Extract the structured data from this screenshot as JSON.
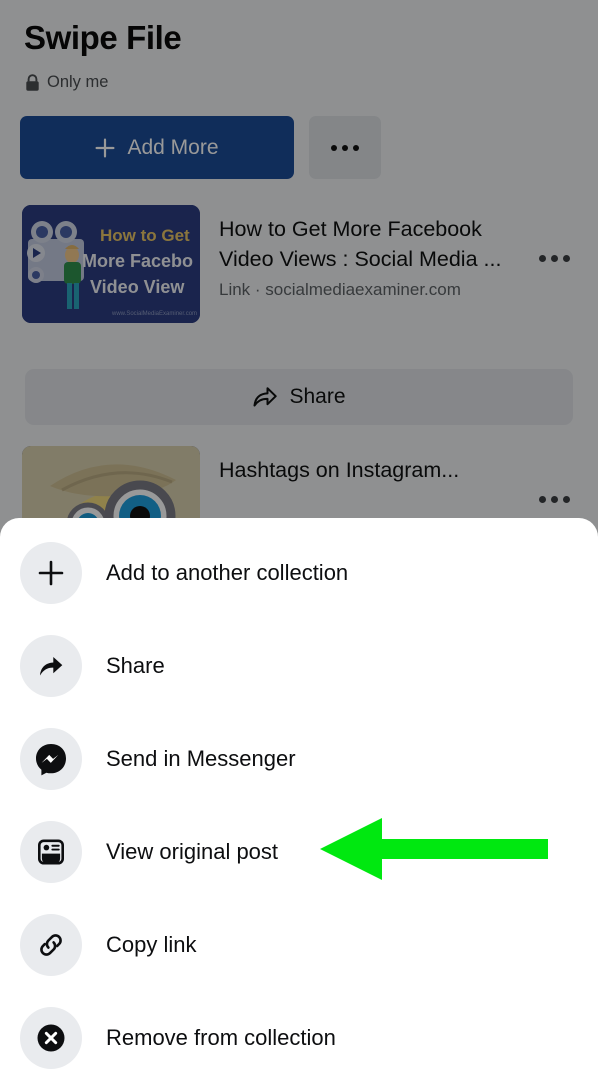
{
  "colors": {
    "primary_button": "#1b4b96",
    "sheet_background": "#ffffff",
    "overlay": "#999999",
    "annotation_arrow": "#00e810",
    "icon_circle": "#e9ebee"
  },
  "background_page": {
    "title": "Swipe File",
    "privacy": {
      "icon": "lock-icon",
      "label": "Only me"
    },
    "actions": {
      "add_more_label": "Add More",
      "add_more_icon": "plus-icon",
      "more_options_icon": "ellipsis-icon"
    },
    "saved_items": [
      {
        "title": "How to Get More Facebook Video Views : Social Media ...",
        "subtitle": "Link · socialmediaexaminer.com",
        "thumbnail_alt": "How to Get More Facebook Video Views",
        "overflow_icon": "ellipsis-icon"
      },
      {
        "title": "Hashtags on Instagram...",
        "subtitle": "",
        "thumbnail_alt": "Detective minion with magnifying glass",
        "overflow_icon": "ellipsis-icon"
      }
    ],
    "share_bar": {
      "label": "Share",
      "icon": "share-arrow-icon"
    }
  },
  "bottom_sheet": {
    "menu_items": [
      {
        "label": "Add to another collection",
        "icon": "plus-icon"
      },
      {
        "label": "Share",
        "icon": "share-arrow-icon"
      },
      {
        "label": "Send in Messenger",
        "icon": "messenger-icon"
      },
      {
        "label": "View original post",
        "icon": "post-article-icon"
      },
      {
        "label": "Copy link",
        "icon": "link-chain-icon"
      },
      {
        "label": "Remove from collection",
        "icon": "close-circle-icon"
      }
    ]
  },
  "annotation": {
    "arrow_icon": "arrow-left-icon",
    "points_at": "View original post"
  }
}
